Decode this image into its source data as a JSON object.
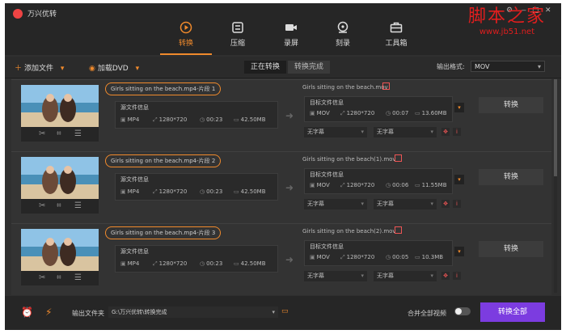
{
  "app": {
    "title": "万兴优转"
  },
  "nav": {
    "tabs": [
      {
        "label": "转换",
        "active": true
      },
      {
        "label": "压缩"
      },
      {
        "label": "录屏"
      },
      {
        "label": "刻录"
      },
      {
        "label": "工具箱"
      }
    ]
  },
  "toolbar": {
    "add_file": "添加文件",
    "load_dvd": "加载DVD",
    "seg_converting": "正在转换",
    "seg_done": "转换完成",
    "output_format_label": "输出格式:",
    "output_format_value": "MOV"
  },
  "rows": [
    {
      "source_name": "Girls sitting on the beach.mp4-片段 1",
      "source_title": "源文件信息",
      "source": {
        "format": "MP4",
        "resolution": "1280*720",
        "duration": "00:23",
        "size": "42.50MB"
      },
      "target_name": "Girls sitting on the beach.mov",
      "target_title": "目标文件信息",
      "target": {
        "format": "MOV",
        "resolution": "1280*720",
        "duration": "00:07",
        "size": "13.60MB"
      },
      "subtitle": "无字幕",
      "audio": "无字幕",
      "convert_label": "转换"
    },
    {
      "source_name": "Girls sitting on the beach.mp4-片段 2",
      "source_title": "源文件信息",
      "source": {
        "format": "MP4",
        "resolution": "1280*720",
        "duration": "00:23",
        "size": "42.50MB"
      },
      "target_name": "Girls sitting on the beach(1).mov",
      "target_title": "目标文件信息",
      "target": {
        "format": "MOV",
        "resolution": "1280*720",
        "duration": "00:06",
        "size": "11.55MB"
      },
      "subtitle": "无字幕",
      "audio": "无字幕",
      "convert_label": "转换"
    },
    {
      "source_name": "Girls sitting on the beach.mp4-片段 3",
      "source_title": "源文件信息",
      "source": {
        "format": "MP4",
        "resolution": "1280*720",
        "duration": "00:23",
        "size": "42.50MB"
      },
      "target_name": "Girls sitting on the beach(2).mov",
      "target_title": "目标文件信息",
      "target": {
        "format": "MOV",
        "resolution": "1280*720",
        "duration": "00:05",
        "size": "10.3MB"
      },
      "subtitle": "无字幕",
      "audio": "无字幕",
      "convert_label": "转换"
    }
  ],
  "footer": {
    "output_folder_label": "输出文件夹",
    "output_path": "G:\\万兴优转\\转换完成",
    "merge_label": "合并全部视频",
    "convert_all": "转换全部"
  },
  "watermark": {
    "main": "脚本之家",
    "url": "www.jb51.net"
  },
  "colors": {
    "accent": "#f08a2c",
    "primary_button": "#7c3ce0",
    "background": "#2f2f2f"
  }
}
